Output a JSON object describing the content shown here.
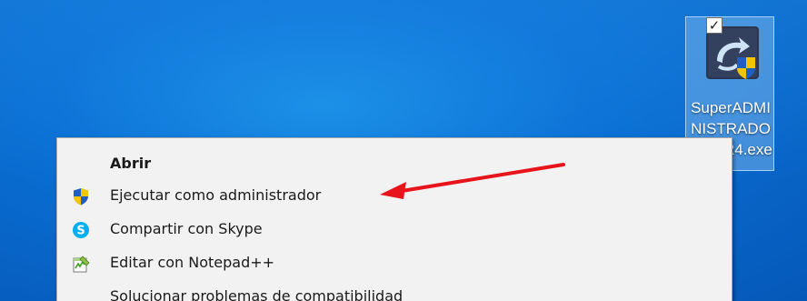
{
  "desktop_icon": {
    "label": "SuperADMINISTRADOR_2024.exe",
    "checked_glyph": "✓"
  },
  "context_menu": {
    "items": [
      {
        "label": "Abrir",
        "icon": "none",
        "bold": true
      },
      {
        "label": "Ejecutar como administrador",
        "icon": "uac-shield-icon"
      },
      {
        "label": "Compartir con Skype",
        "icon": "skype-icon"
      },
      {
        "label": "Editar con Notepad++",
        "icon": "notepad-plus-plus-icon"
      },
      {
        "label": "Solucionar problemas de compatibilidad",
        "icon": "none"
      }
    ]
  },
  "colors": {
    "desktop_blue": "#0a6fd3",
    "menu_bg": "#f2f2f2",
    "annotation_arrow": "#e8141b",
    "skype_blue": "#00aff0",
    "shield_blue": "#1f5fc2",
    "shield_yellow": "#f5c400"
  }
}
